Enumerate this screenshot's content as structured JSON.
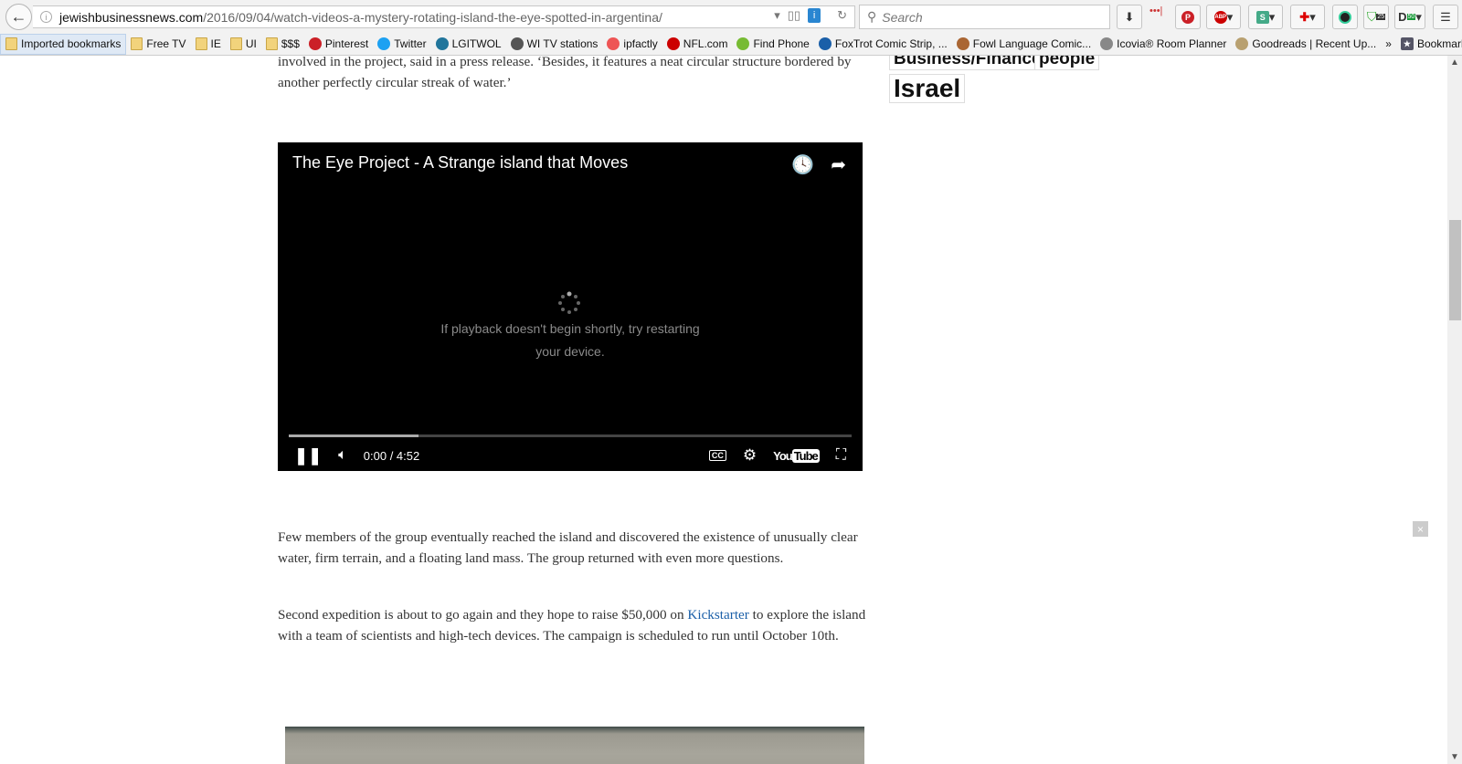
{
  "browser": {
    "url_domain": "jewishbusinessnews.com",
    "url_path": "/2016/09/04/watch-videos-a-mystery-rotating-island-the-eye-spotted-in-argentina/",
    "search_placeholder": "Search",
    "bookmarks": [
      {
        "label": "Imported bookmarks",
        "icon": "folder-icon"
      },
      {
        "label": "Free TV",
        "icon": "folder-icon"
      },
      {
        "label": "IE",
        "icon": "folder-icon"
      },
      {
        "label": "UI",
        "icon": "folder-icon"
      },
      {
        "label": "$$$",
        "icon": "folder-icon"
      },
      {
        "label": "Pinterest",
        "icon": "pinterest-icon"
      },
      {
        "label": "Twitter",
        "icon": "twitter-icon"
      },
      {
        "label": "LGITWOL",
        "icon": "wordpress-icon"
      },
      {
        "label": "WI TV stations",
        "icon": "wikipedia-icon"
      },
      {
        "label": "ipfactly",
        "icon": "ipfactly-icon"
      },
      {
        "label": "NFL.com",
        "icon": "nfl-icon"
      },
      {
        "label": "Find Phone",
        "icon": "find-phone-icon"
      },
      {
        "label": "FoxTrot Comic Strip, ...",
        "icon": "foxtrot-icon"
      },
      {
        "label": "Fowl Language Comic...",
        "icon": "fowl-language-icon"
      },
      {
        "label": "Icovia® Room Planner",
        "icon": "globe-icon"
      },
      {
        "label": "Goodreads | Recent Up...",
        "icon": "goodreads-icon"
      }
    ],
    "overflow": "»",
    "bookmarks_menu": "Bookmarks",
    "badges": {
      "ext1": "25",
      "ext2": "50"
    }
  },
  "article": {
    "para0": "involved in the project, said in a press release. ‘Besides, it features a neat circular structure bordered by another perfectly circular streak of water.’",
    "para1": "Few members of the group eventually reached the island and discovered the existence of unusually clear water, firm terrain, and a floating land mass. The group returned with even more questions.",
    "para2_a": "Second expedition is about to go again and they hope to raise $50,000 on ",
    "para2_link": "Kickstarter",
    "para2_b": " to explore the island with a team of scientists and high-tech devices. The campaign is scheduled to run until October 10th."
  },
  "video": {
    "title": "The Eye Project - A Strange island that Moves",
    "message": "If playback doesn't begin shortly, try restarting your device.",
    "time": "0:00 / 4:52",
    "buffered_percent": 23,
    "cc": "CC",
    "youtube_a": "You",
    "youtube_b": "Tube"
  },
  "sidebar": {
    "tags": [
      "Business/Finance",
      "people",
      "Israel"
    ]
  },
  "close": "×"
}
